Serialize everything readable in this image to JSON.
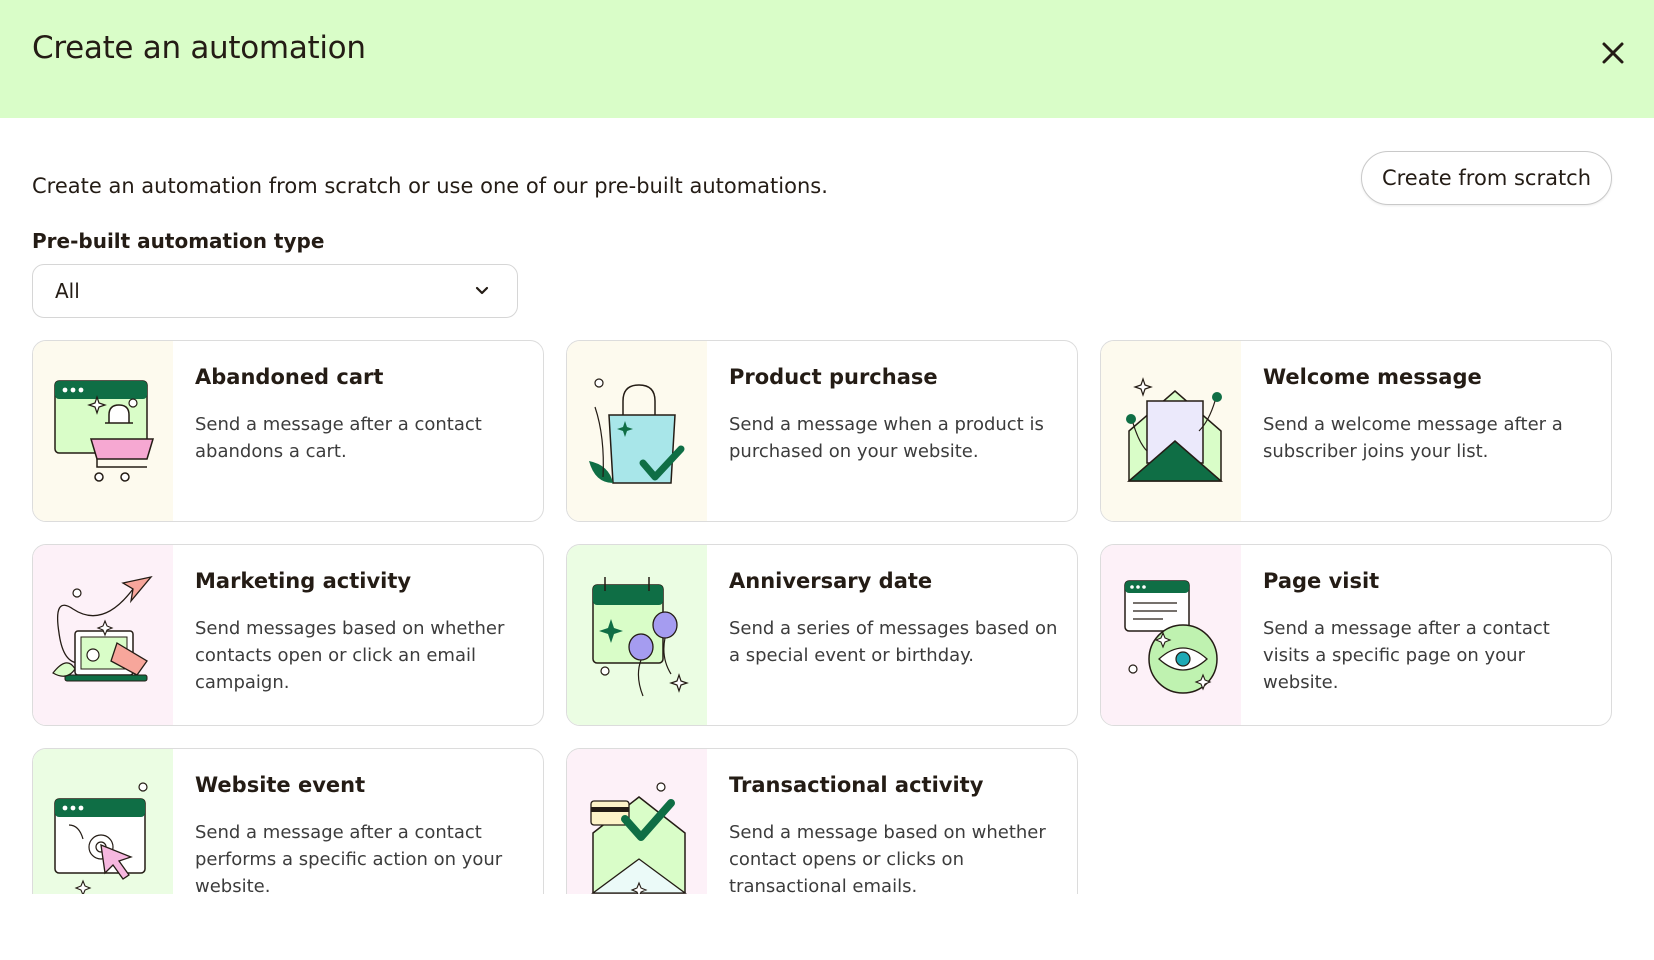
{
  "header": {
    "title": "Create an automation"
  },
  "intro": {
    "text": "Create an automation from scratch or use one of our pre-built automations."
  },
  "scratch_button": {
    "label": "Create from scratch"
  },
  "filter": {
    "label": "Pre-built automation type",
    "selected": "All"
  },
  "cards": [
    {
      "title": "Abandoned cart",
      "description": "Send a message after a contact abandons a cart.",
      "icon": "shopping-cart-illustration"
    },
    {
      "title": "Product purchase",
      "description": "Send a message when a product is purchased on your website.",
      "icon": "shopping-bag-illustration"
    },
    {
      "title": "Welcome message",
      "description": "Send a welcome message after a subscriber joins your list.",
      "icon": "envelope-letter-illustration"
    },
    {
      "title": "Marketing activity",
      "description": "Send messages based on whether contacts open or click an email campaign.",
      "icon": "megaphone-laptop-illustration"
    },
    {
      "title": "Anniversary date",
      "description": "Send a series of messages based on a special event or birthday.",
      "icon": "calendar-balloons-illustration"
    },
    {
      "title": "Page visit",
      "description": "Send a message after a contact visits a specific page on your website.",
      "icon": "eye-browser-illustration"
    },
    {
      "title": "Website event",
      "description": "Send a message after a contact performs a specific action on your website.",
      "icon": "browser-cursor-illustration"
    },
    {
      "title": "Transactional activity",
      "description": "Send a message based on whether contact opens or clicks on transactional emails.",
      "icon": "envelope-card-illustration"
    }
  ],
  "colors": {
    "header_bg": "#d9fdc8",
    "dark_green": "#0f6e45",
    "text": "#241c15"
  }
}
